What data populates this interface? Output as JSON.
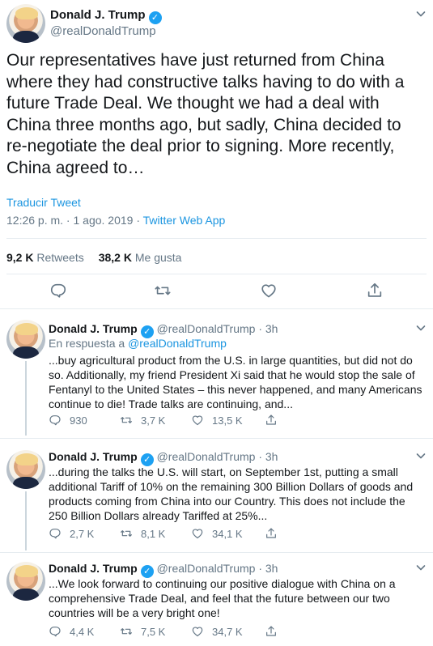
{
  "main": {
    "name": "Donald J. Trump",
    "handle": "@realDonaldTrump",
    "text": "Our representatives have just returned from China where they had constructive talks having to do with a future Trade Deal. We thought we had a deal with China three months ago, but sadly, China decided to re-negotiate the deal prior to signing. More recently, China agreed to…",
    "translate": "Traducir Tweet",
    "meta": {
      "time_date": "12:26 p. m. · 1 ago. 2019 · ",
      "source": "Twitter Web App"
    },
    "stats": {
      "retweets_count": "9,2 K",
      "retweets_label": "Retweets",
      "likes_count": "38,2 K",
      "likes_label": "Me gusta"
    }
  },
  "replies": [
    {
      "name": "Donald J. Trump",
      "handle": "@realDonaldTrump · 3h",
      "reply_prefix": "En respuesta a ",
      "reply_to": "@realDonaldTrump",
      "text": "...buy agricultural product from the U.S. in large quantities, but did not do so. Additionally, my friend President Xi said that he would stop the sale of Fentanyl to the United States – this never happened, and many Americans continue to die! Trade talks are continuing, and...",
      "replies_count": "930",
      "retweets_count": "3,7 K",
      "likes_count": "13,5 K"
    },
    {
      "name": "Donald J. Trump",
      "handle": "@realDonaldTrump · 3h",
      "text": "...during the talks the U.S. will start, on September 1st, putting a small additional Tariff of 10% on the remaining 300 Billion Dollars of goods and products coming from China into our Country. This does not include the 250 Billion Dollars already Tariffed at 25%...",
      "replies_count": "2,7 K",
      "retweets_count": "8,1 K",
      "likes_count": "34,1 K"
    },
    {
      "name": "Donald J. Trump",
      "handle": "@realDonaldTrump · 3h",
      "text": "...We look forward to continuing our positive dialogue with China on a comprehensive Trade Deal, and feel that the future between our two countries will be a very bright one!",
      "replies_count": "4,4 K",
      "retweets_count": "7,5 K",
      "likes_count": "34,7 K"
    }
  ],
  "colors": {
    "blue": "#1b95e0",
    "gray": "#657786",
    "verified": "#1da1f2"
  },
  "icons": [
    "verified-badge-icon",
    "chevron-down-icon",
    "reply-icon",
    "retweet-icon",
    "like-icon",
    "share-icon"
  ]
}
